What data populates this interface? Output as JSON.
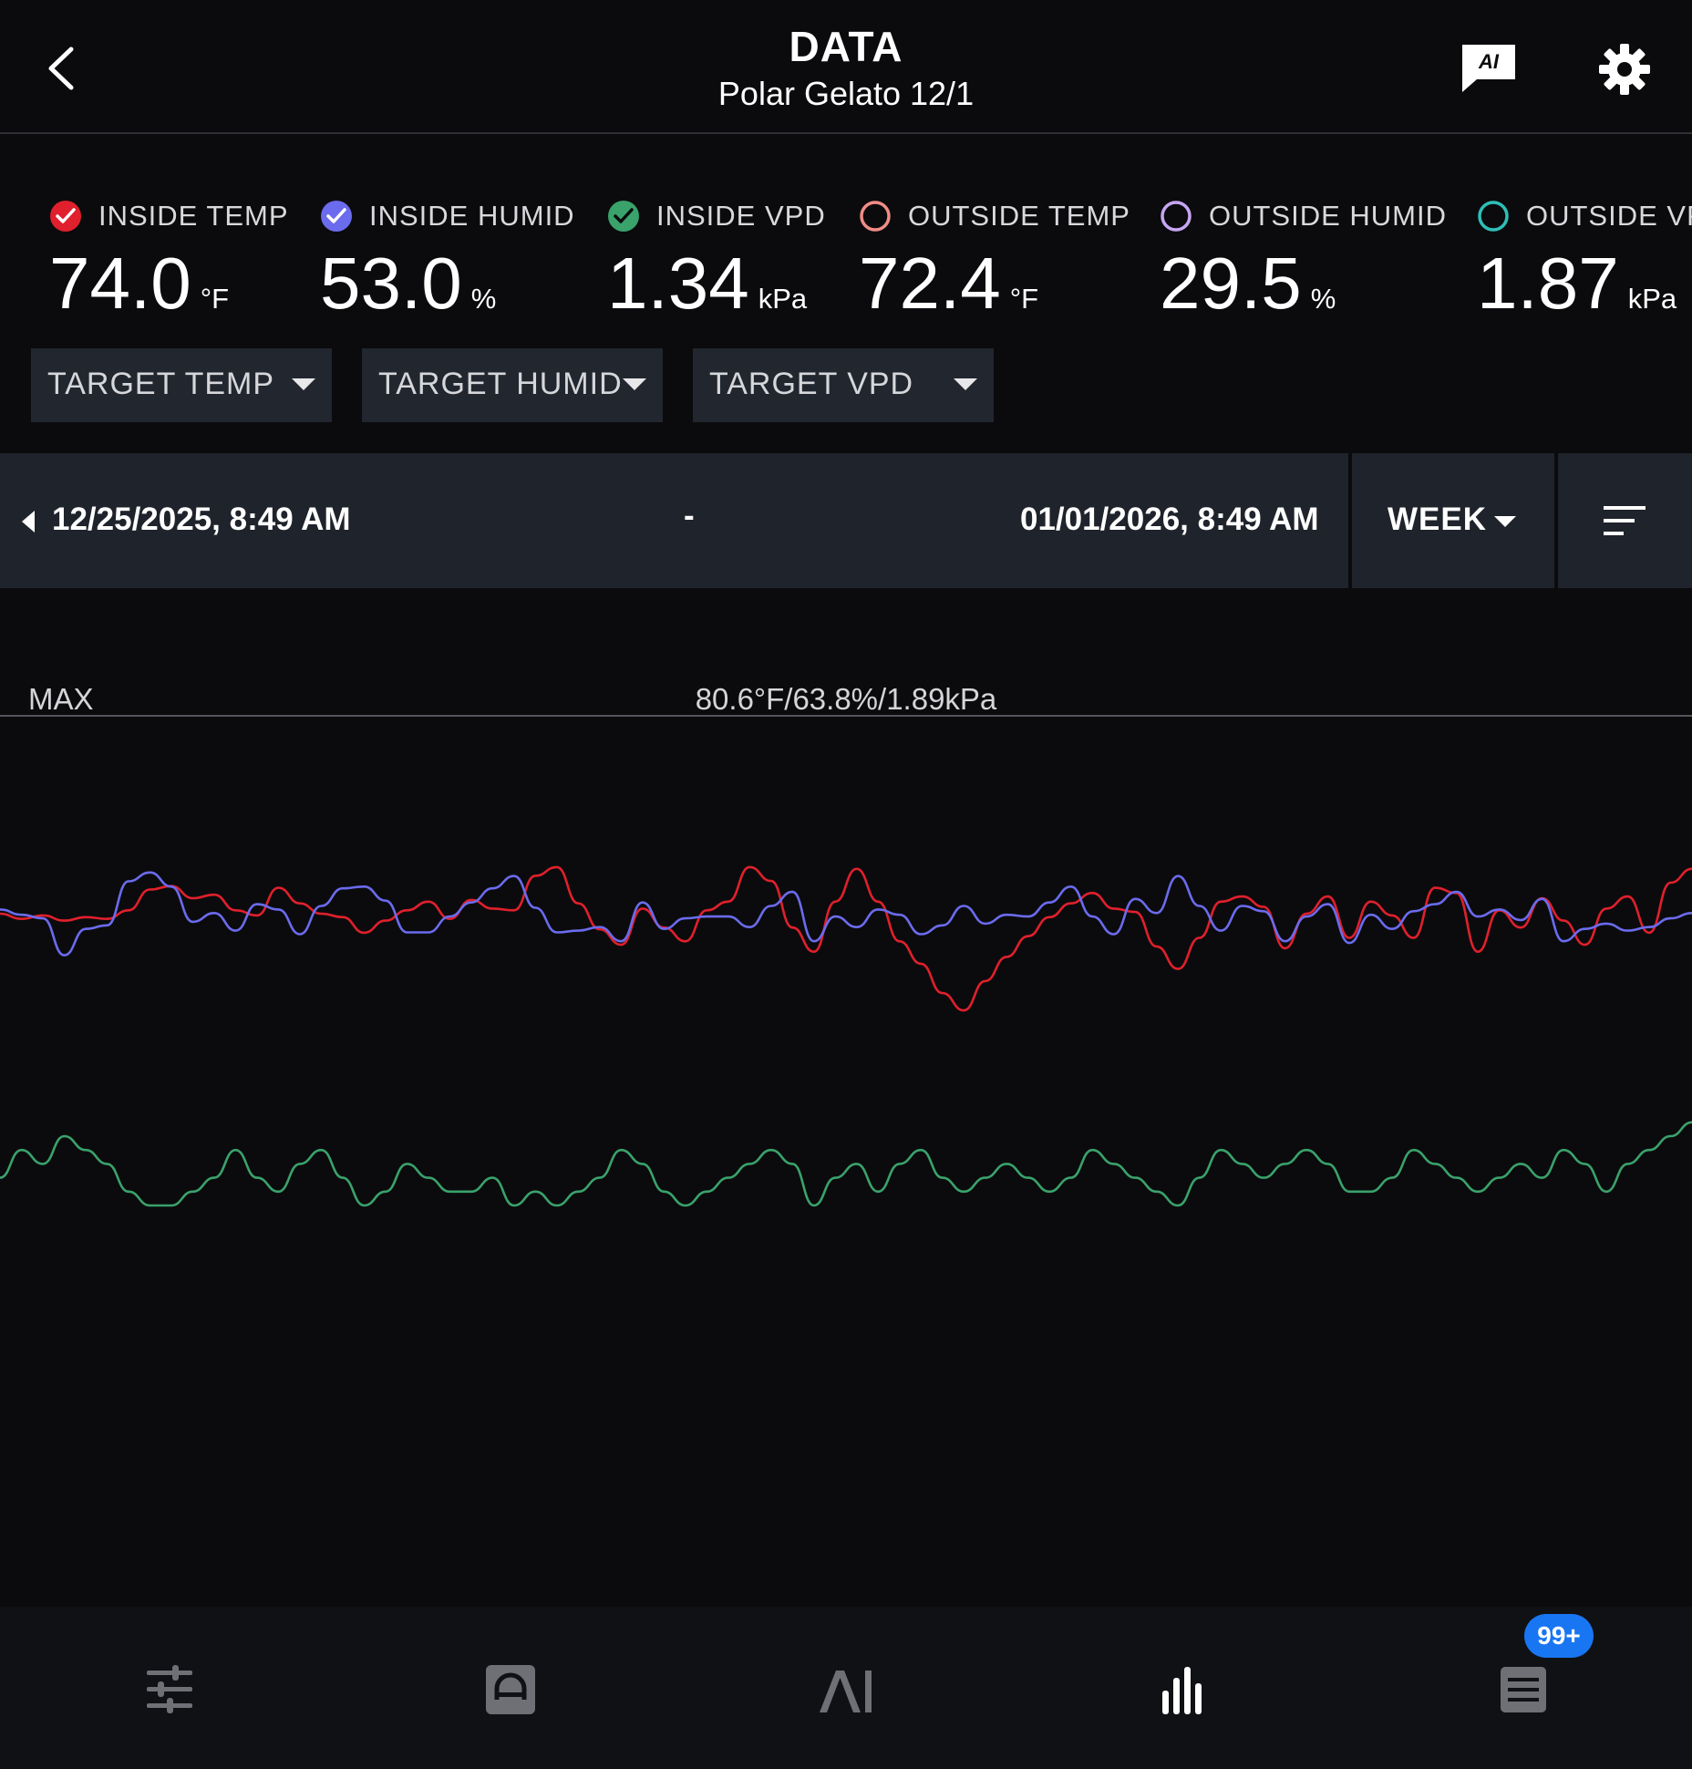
{
  "header": {
    "title": "DATA",
    "subtitle": "Polar Gelato 12/1",
    "ai_icon_text": "AI"
  },
  "metrics": [
    {
      "label": "INSIDE TEMP",
      "value": "74.0",
      "unit": "°F",
      "checked": true,
      "color": "#e0202c"
    },
    {
      "label": "INSIDE HUMID",
      "value": "53.0",
      "unit": "%",
      "checked": true,
      "color": "#6b6bee"
    },
    {
      "label": "INSIDE VPD",
      "value": "1.34",
      "unit": "kPa",
      "checked": true,
      "color": "#3aa26b"
    },
    {
      "label": "OUTSIDE TEMP",
      "value": "72.4",
      "unit": "°F",
      "checked": false,
      "color": "#f08c86"
    },
    {
      "label": "OUTSIDE HUMID",
      "value": "29.5",
      "unit": "%",
      "checked": false,
      "color": "#c7a6f2"
    },
    {
      "label": "OUTSIDE VPD",
      "value": "1.87",
      "unit": "kPa",
      "checked": false,
      "color": "#2ebfb8"
    }
  ],
  "targets": [
    "TARGET TEMP",
    "TARGET HUMID",
    "TARGET VPD"
  ],
  "date_range": {
    "start": "12/25/2025, 8:49 AM",
    "separator": "-",
    "end": "01/01/2026, 8:49 AM",
    "period": "WEEK"
  },
  "chart_data": {
    "type": "line",
    "max_label": "MAX",
    "max_value": "80.6°F/63.8%/1.89kPa",
    "series": [
      {
        "name": "INSIDE TEMP",
        "color": "#e0202c",
        "values": [
          69.4,
          69.1,
          69.3,
          69.0,
          69.2,
          69.1,
          69.6,
          70.8,
          71.0,
          70.3,
          70.5,
          69.6,
          69.3,
          70.9,
          70.0,
          69.4,
          69.2,
          68.3,
          69.0,
          69.6,
          70.1,
          69.1,
          70.2,
          69.7,
          69.6,
          71.6,
          72.1,
          70.0,
          68.5,
          67.6,
          69.7,
          68.6,
          67.8,
          69.6,
          70.1,
          72.1,
          71.3,
          68.6,
          67.2,
          70.1,
          72.0,
          70.1,
          67.8,
          66.5,
          64.8,
          63.8,
          65.5,
          66.9,
          68.1,
          69.2,
          70.0,
          70.6,
          69.7,
          69.5,
          67.5,
          66.2,
          68.0,
          70.1,
          70.4,
          69.8,
          67.4,
          69.4,
          70.4,
          68.0,
          70.1,
          69.3,
          68.0,
          70.9,
          70.6,
          67.2,
          69.6,
          68.6,
          70.3,
          69.0,
          67.6,
          69.7,
          70.4,
          68.3,
          71.2,
          72.0
        ]
      },
      {
        "name": "INSIDE HUMID",
        "color": "#6b6bee",
        "values": [
          51.0,
          50.7,
          50.5,
          48.4,
          49.9,
          50.1,
          52.6,
          53.1,
          52.3,
          50.3,
          50.8,
          49.8,
          51.3,
          51.0,
          49.6,
          51.2,
          52.2,
          52.3,
          51.5,
          49.7,
          49.7,
          50.6,
          51.4,
          52.2,
          52.9,
          51.1,
          49.7,
          49.8,
          50.0,
          49.2,
          51.4,
          49.9,
          50.5,
          50.6,
          50.6,
          50.0,
          51.2,
          52.0,
          49.2,
          50.6,
          50.0,
          51.0,
          50.7,
          49.6,
          50.1,
          51.2,
          50.2,
          50.7,
          50.6,
          51.4,
          52.3,
          50.6,
          49.6,
          51.6,
          50.8,
          52.9,
          51.2,
          49.8,
          51.2,
          50.9,
          49.2,
          50.6,
          51.3,
          49.1,
          50.7,
          49.9,
          50.9,
          51.3,
          52.0,
          50.6,
          51.0,
          50.4,
          51.6,
          49.2,
          49.9,
          50.2,
          49.8,
          50.0,
          50.5,
          50.8
        ]
      },
      {
        "name": "INSIDE VPD",
        "color": "#3aa26b",
        "values": [
          1.27,
          1.29,
          1.28,
          1.3,
          1.29,
          1.28,
          1.26,
          1.25,
          1.25,
          1.26,
          1.27,
          1.29,
          1.27,
          1.26,
          1.28,
          1.29,
          1.27,
          1.25,
          1.26,
          1.28,
          1.27,
          1.26,
          1.26,
          1.27,
          1.25,
          1.26,
          1.25,
          1.26,
          1.27,
          1.29,
          1.28,
          1.26,
          1.25,
          1.26,
          1.27,
          1.28,
          1.29,
          1.28,
          1.25,
          1.27,
          1.28,
          1.26,
          1.28,
          1.29,
          1.27,
          1.26,
          1.27,
          1.28,
          1.27,
          1.26,
          1.27,
          1.29,
          1.28,
          1.27,
          1.26,
          1.25,
          1.27,
          1.29,
          1.28,
          1.27,
          1.28,
          1.29,
          1.28,
          1.26,
          1.26,
          1.27,
          1.29,
          1.28,
          1.27,
          1.26,
          1.27,
          1.28,
          1.27,
          1.29,
          1.28,
          1.26,
          1.28,
          1.29,
          1.3,
          1.31
        ]
      }
    ]
  },
  "nav": [
    "controls-tab",
    "automation-tab",
    "ai-tab",
    "data-tab",
    "notifications-tab"
  ],
  "badge": "99+"
}
